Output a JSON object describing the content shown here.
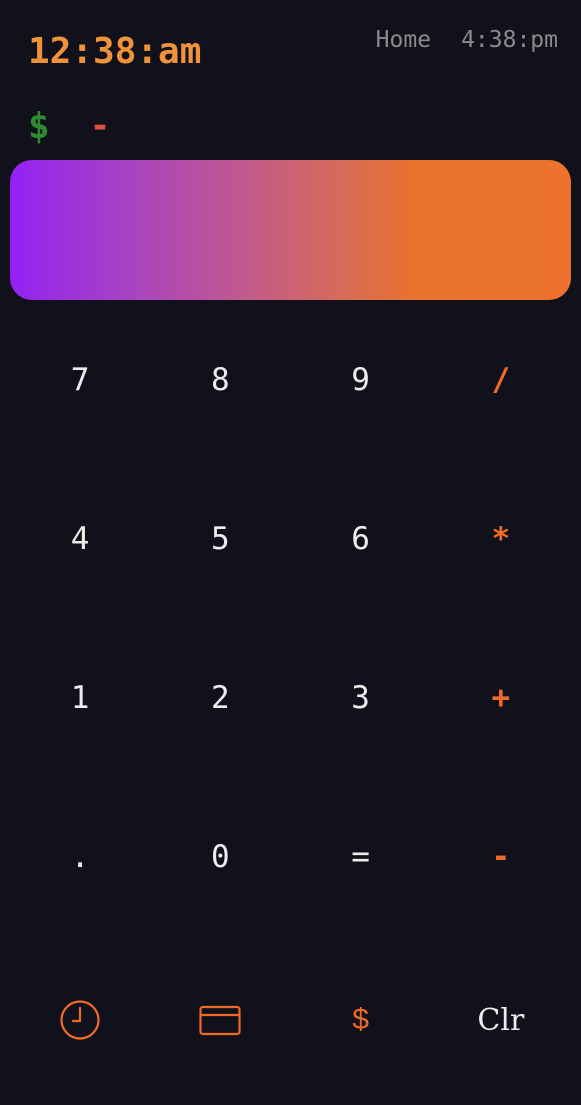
{
  "header": {
    "time": "12:38:am",
    "location": "Home",
    "secondary_time": "4:38:pm"
  },
  "prompt": {
    "symbol": "$",
    "value": "-"
  },
  "display": {
    "gradient_colors": [
      "#9421f4",
      "#c25a8d",
      "#ec722d"
    ]
  },
  "keypad": {
    "rows": [
      [
        "7",
        "8",
        "9",
        "/"
      ],
      [
        "4",
        "5",
        "6",
        "*"
      ],
      [
        "1",
        "2",
        "3",
        "+"
      ],
      [
        ".",
        "0",
        "=",
        "-"
      ]
    ]
  },
  "bottom_bar": {
    "items": [
      {
        "icon": "clock-icon"
      },
      {
        "icon": "card-icon"
      },
      {
        "icon": "dollar-icon",
        "label": "$"
      },
      {
        "label": "Clr"
      }
    ]
  },
  "colors": {
    "background": "#11111b",
    "accent": "#ef6a27",
    "time": "#f0923a",
    "prompt_symbol": "#2e8b2e",
    "prompt_value": "#e04f3f"
  }
}
